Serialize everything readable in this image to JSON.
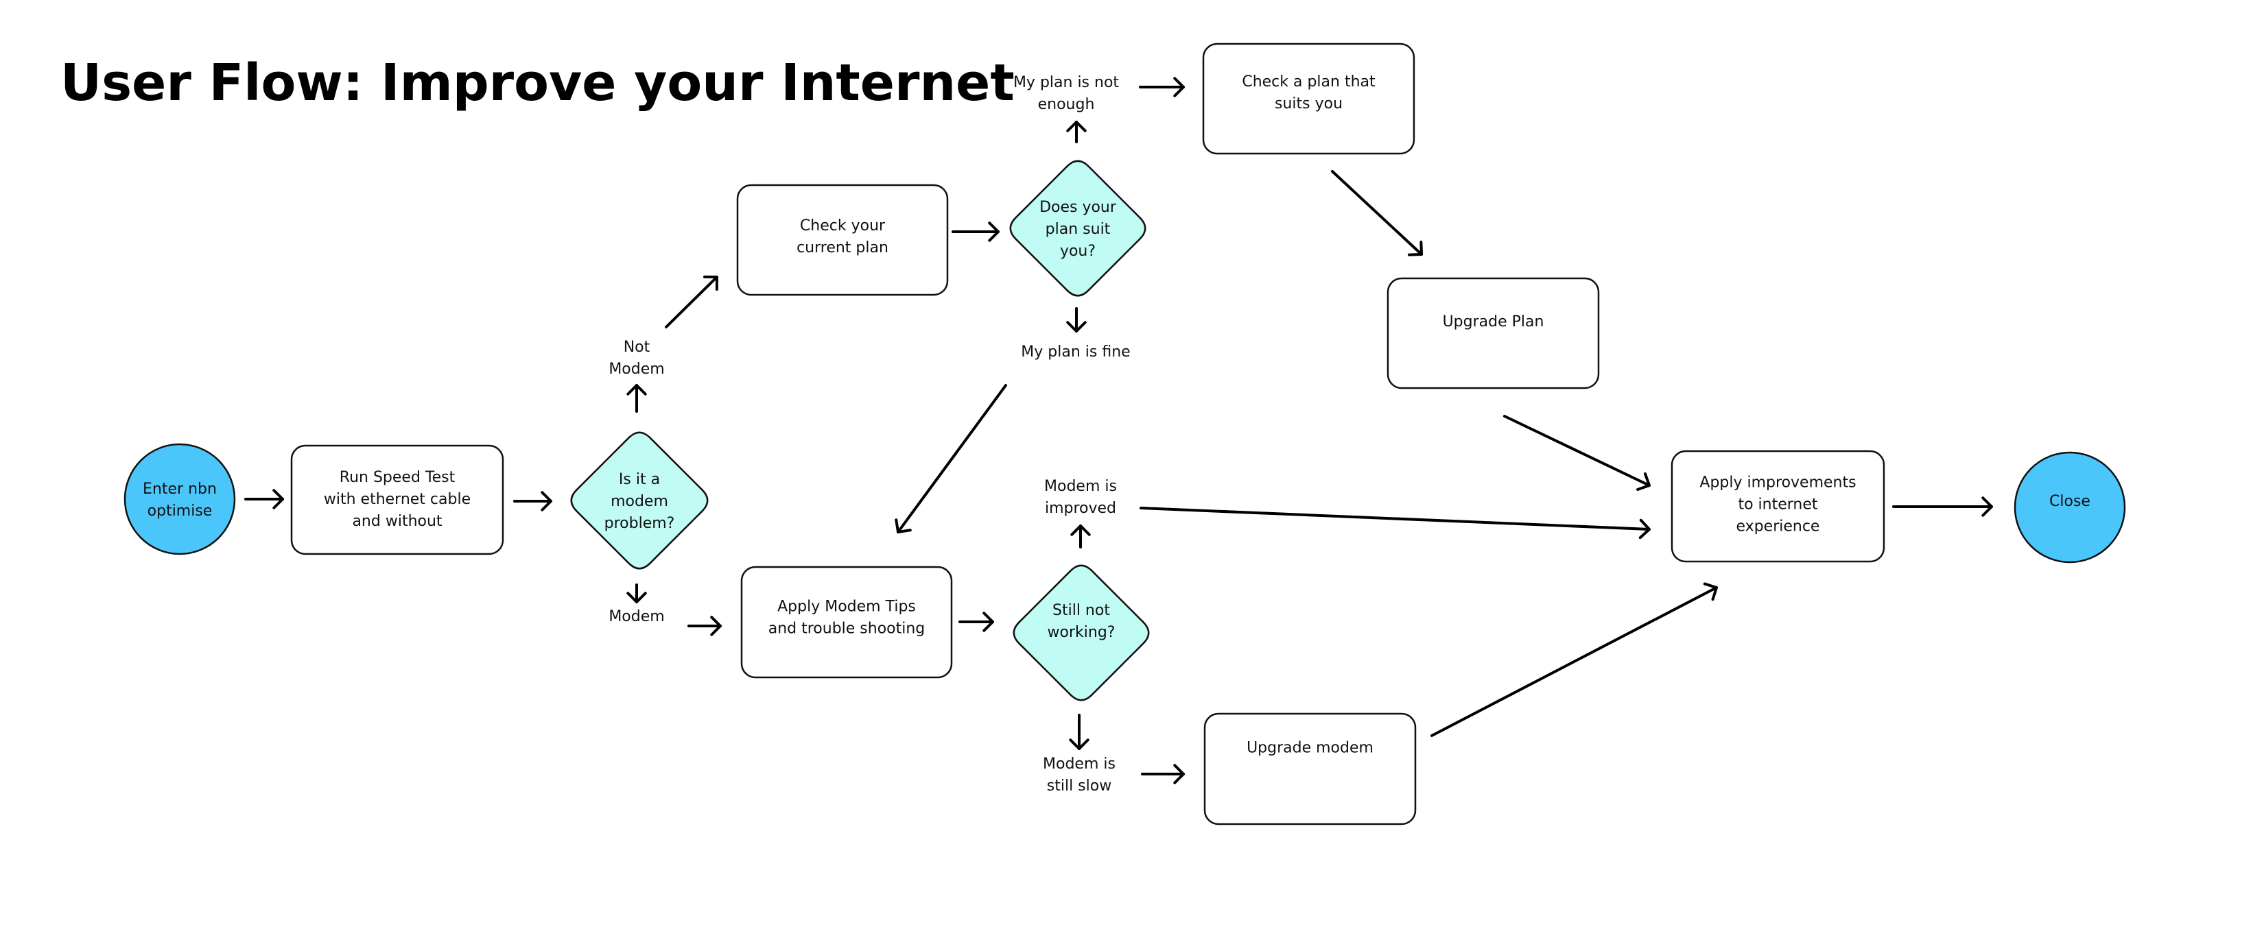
{
  "title": "User Flow:  Improve your Internet",
  "colors": {
    "terminal_fill": "#4BC6FB",
    "decision_fill": "#C0FBF4",
    "process_fill": "#FFFFFF",
    "stroke": "#111111"
  },
  "nodes": {
    "enter": {
      "type": "terminal",
      "lines": [
        "Enter nbn",
        "optimise"
      ]
    },
    "speed_test": {
      "type": "process",
      "lines": [
        "Run Speed Test",
        "with ethernet cable",
        "and without"
      ]
    },
    "modem_problem": {
      "type": "decision",
      "lines": [
        "Is it a",
        "modem",
        "problem?"
      ]
    },
    "check_current_plan": {
      "type": "process",
      "lines": [
        "Check your",
        "current plan"
      ]
    },
    "plan_suit": {
      "type": "decision",
      "lines": [
        "Does your",
        "plan suit",
        "you?"
      ]
    },
    "check_plan_suits": {
      "type": "process",
      "lines": [
        "Check a plan that",
        "suits you"
      ]
    },
    "upgrade_plan": {
      "type": "process",
      "lines": [
        "Upgrade Plan"
      ]
    },
    "modem_tips": {
      "type": "process",
      "lines": [
        "Apply Modem Tips",
        "and trouble shooting"
      ]
    },
    "still_not_working": {
      "type": "decision",
      "lines": [
        "Still not",
        "working?"
      ]
    },
    "upgrade_modem": {
      "type": "process",
      "lines": [
        "Upgrade modem"
      ]
    },
    "apply_improvements": {
      "type": "process",
      "lines": [
        "Apply improvements",
        "to internet",
        "experience"
      ]
    },
    "close": {
      "type": "terminal",
      "lines": [
        "Close"
      ]
    }
  },
  "labels": {
    "not_modem": [
      "Not",
      "Modem"
    ],
    "modem": [
      "Modem"
    ],
    "plan_not_enough": [
      "My plan is not",
      "enough"
    ],
    "plan_fine": [
      "My plan is fine"
    ],
    "modem_improved": [
      "Modem is",
      "improved"
    ],
    "modem_still_slow": [
      "Modem is",
      "still slow"
    ]
  },
  "edges": [
    {
      "from": "enter",
      "to": "speed_test"
    },
    {
      "from": "speed_test",
      "to": "modem_problem"
    },
    {
      "from": "modem_problem",
      "to": "not_modem"
    },
    {
      "from": "not_modem",
      "to": "check_current_plan"
    },
    {
      "from": "modem_problem",
      "to": "modem"
    },
    {
      "from": "modem",
      "to": "modem_tips"
    },
    {
      "from": "check_current_plan",
      "to": "plan_suit"
    },
    {
      "from": "plan_suit",
      "to": "plan_not_enough"
    },
    {
      "from": "plan_not_enough",
      "to": "check_plan_suits"
    },
    {
      "from": "plan_suit",
      "to": "plan_fine"
    },
    {
      "from": "plan_fine",
      "to": "modem_tips"
    },
    {
      "from": "check_plan_suits",
      "to": "upgrade_plan"
    },
    {
      "from": "upgrade_plan",
      "to": "apply_improvements"
    },
    {
      "from": "modem_tips",
      "to": "still_not_working"
    },
    {
      "from": "still_not_working",
      "to": "modem_improved"
    },
    {
      "from": "modem_improved",
      "to": "apply_improvements"
    },
    {
      "from": "still_not_working",
      "to": "modem_still_slow"
    },
    {
      "from": "modem_still_slow",
      "to": "upgrade_modem"
    },
    {
      "from": "upgrade_modem",
      "to": "apply_improvements"
    },
    {
      "from": "apply_improvements",
      "to": "close"
    }
  ]
}
